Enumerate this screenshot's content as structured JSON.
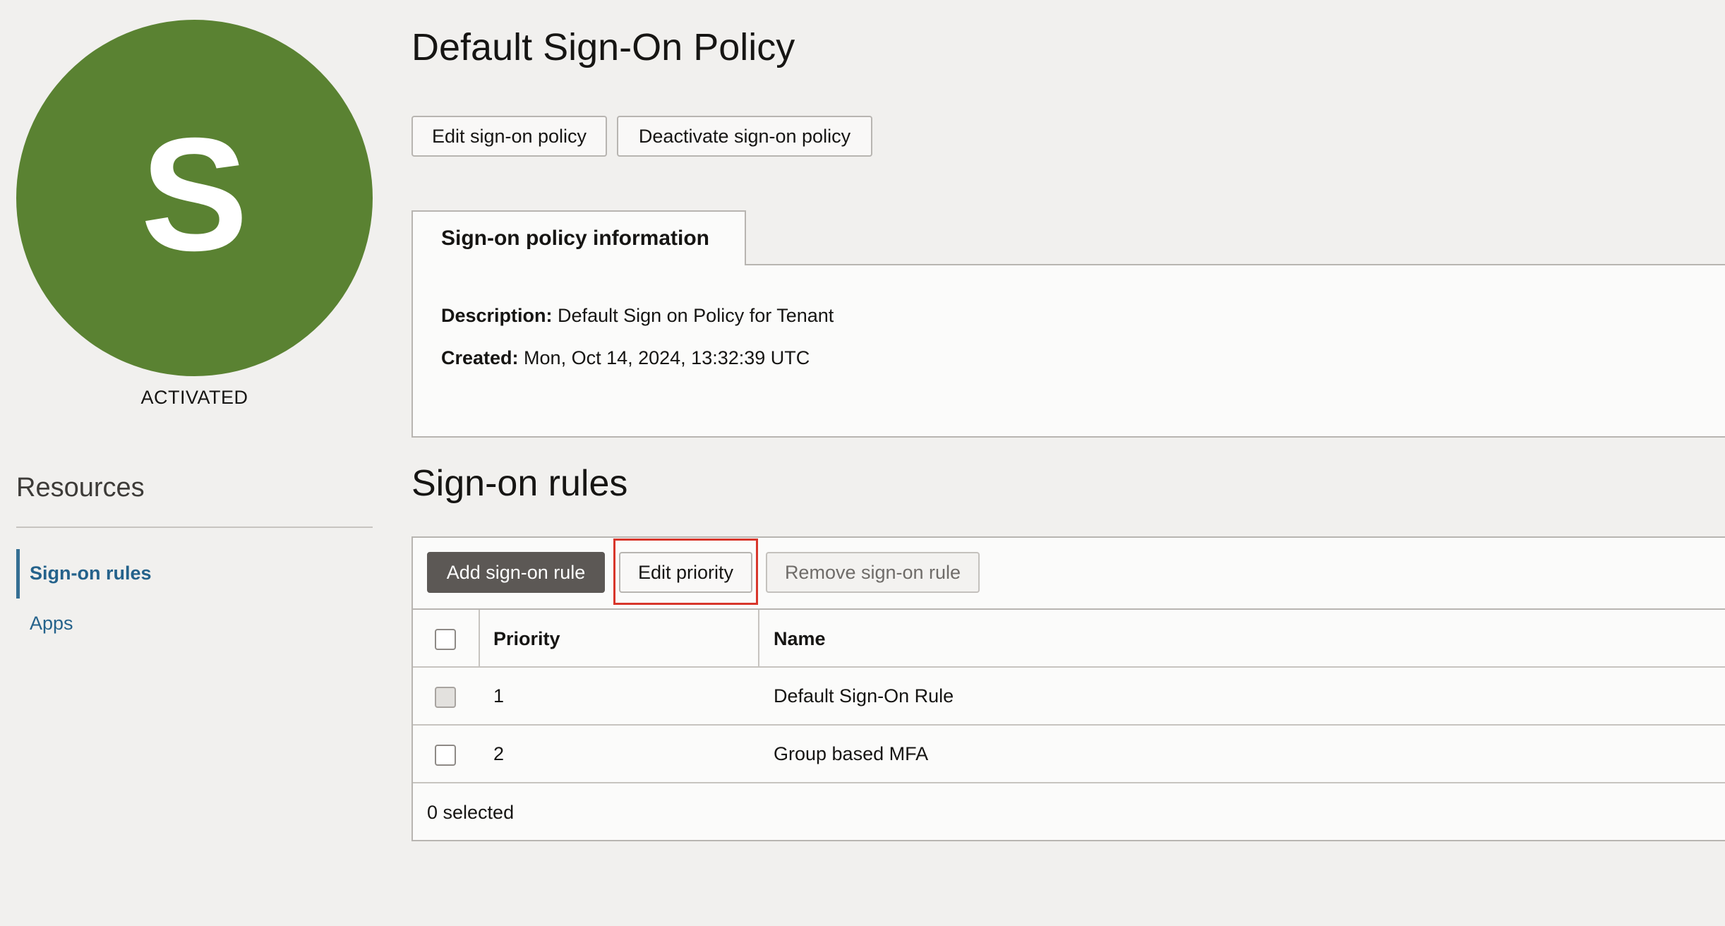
{
  "avatar": {
    "letter": "S",
    "color": "#5a8232",
    "status": "ACTIVATED"
  },
  "resources": {
    "heading": "Resources",
    "items": [
      {
        "label": "Sign-on rules",
        "active": true
      },
      {
        "label": "Apps",
        "active": false
      }
    ]
  },
  "page": {
    "title": "Default Sign-On Policy",
    "actions": {
      "edit": "Edit sign-on policy",
      "deactivate": "Deactivate sign-on policy"
    }
  },
  "info": {
    "tab": "Sign-on policy information",
    "description_label": "Description:",
    "description_value": "Default Sign on Policy for Tenant",
    "created_label": "Created:",
    "created_value": "Mon, Oct 14, 2024, 13:32:39 UTC"
  },
  "rules": {
    "title": "Sign-on rules",
    "toolbar": {
      "add": "Add sign-on rule",
      "edit_priority": "Edit priority",
      "remove": "Remove sign-on rule"
    },
    "columns": [
      "Priority",
      "Name"
    ],
    "rows": [
      {
        "priority": "1",
        "name": "Default Sign-On Rule"
      },
      {
        "priority": "2",
        "name": "Group based MFA"
      }
    ],
    "selected_text": "0 selected"
  },
  "colors": {
    "accent": "#356f93",
    "highlight": "#d8362b",
    "primary_button": "#5c5855"
  }
}
